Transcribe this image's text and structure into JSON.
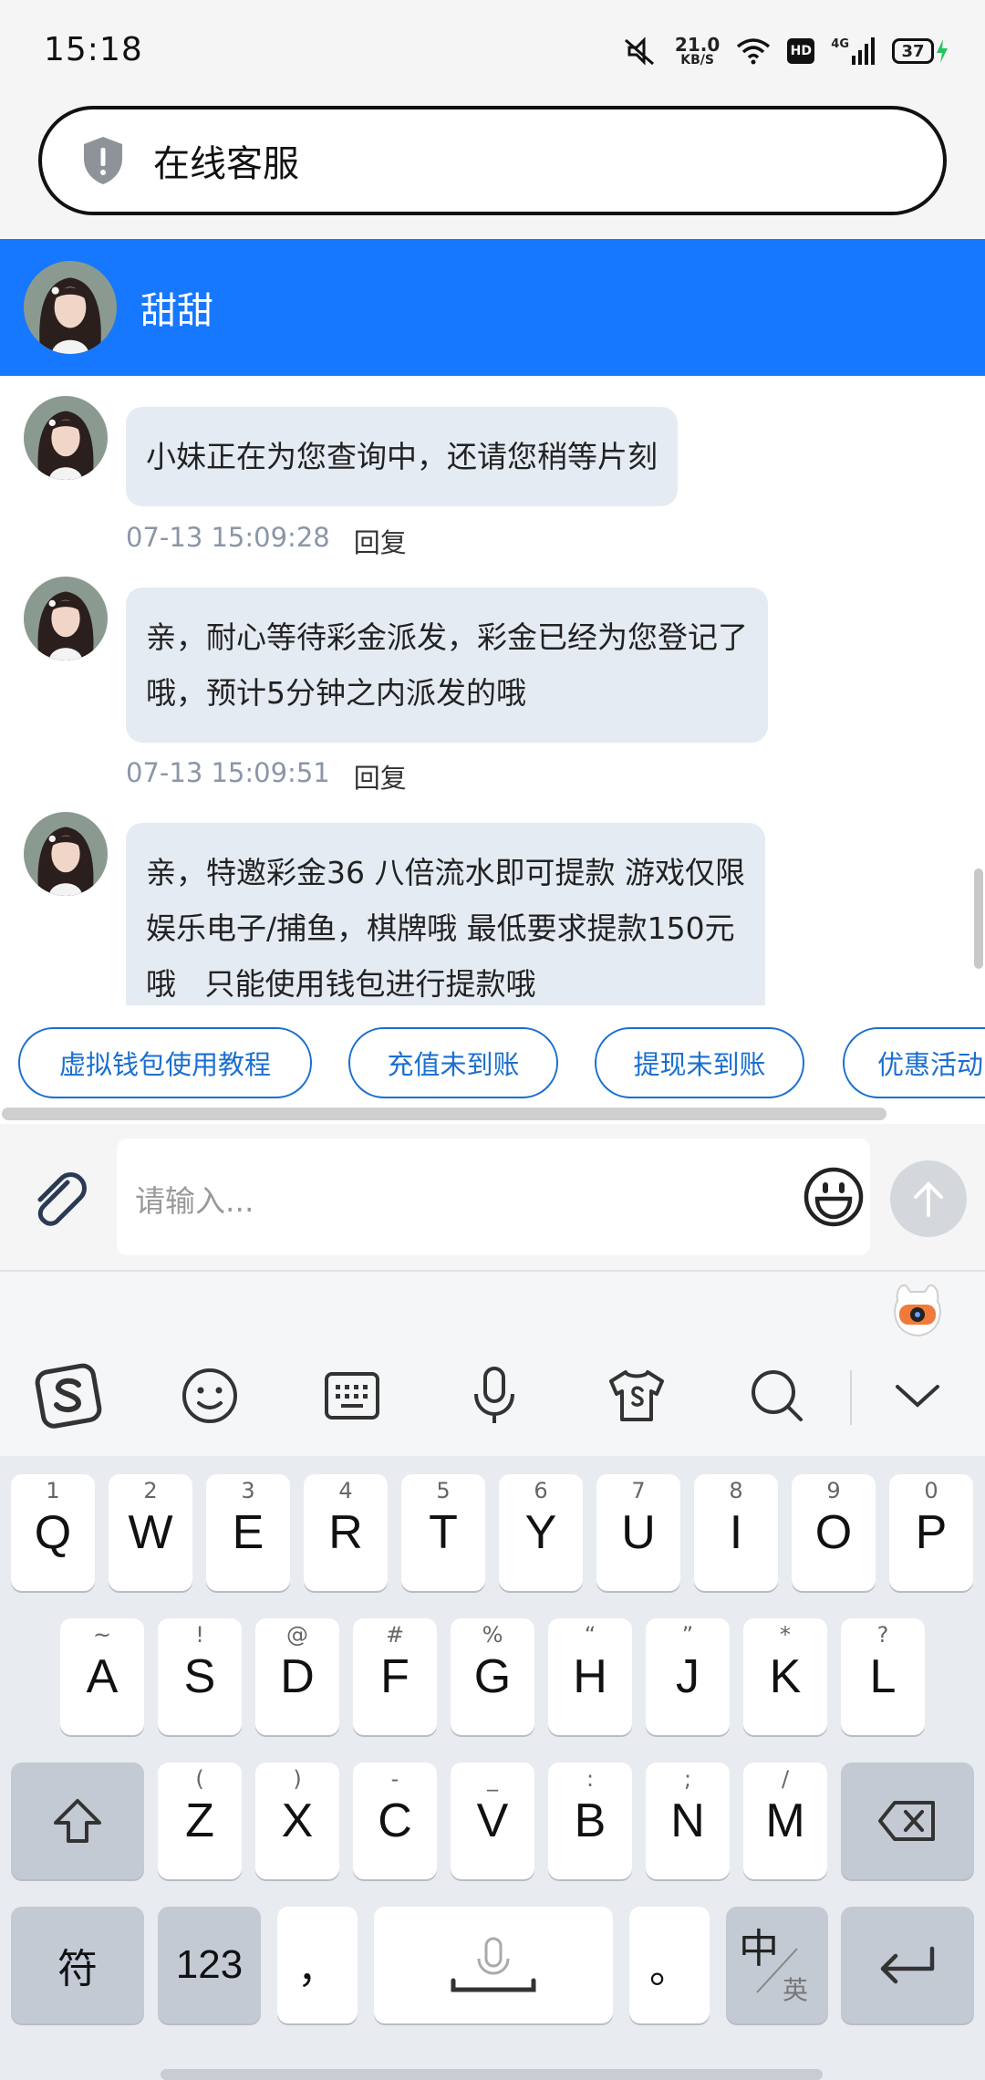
{
  "status_bar": {
    "time": "15:18",
    "net_speed_value": "21.0",
    "net_speed_unit": "KB/S",
    "hd_label": "HD",
    "network_label": "4G",
    "battery": "37"
  },
  "browser": {
    "page_title": "在线客服"
  },
  "chat": {
    "agent_name": "甜甜",
    "reply_label": "回复",
    "messages": [
      {
        "lines": [
          "小妹正在为您查询中，还请您稍等片刻"
        ],
        "time": "07-13 15:09:28"
      },
      {
        "lines": [
          "亲，耐心等待彩金派发，彩金已经为您登记了",
          "哦，预计5分钟之内派发的哦"
        ],
        "time": "07-13 15:09:51"
      },
      {
        "lines": [
          "亲，特邀彩金36 八倍流水即可提款 游戏仅限",
          "娱乐电子/捕鱼，棋牌哦  最低要求提款150元",
          "哦   只能使用钱包进行提款哦"
        ],
        "time": ""
      }
    ]
  },
  "quick_replies": [
    "虚拟钱包使用教程",
    "充值未到账",
    "提现未到账",
    "优惠活动"
  ],
  "input": {
    "placeholder": "请输入..."
  },
  "keyboard": {
    "row1": [
      {
        "k": "Q",
        "s": "1"
      },
      {
        "k": "W",
        "s": "2"
      },
      {
        "k": "E",
        "s": "3"
      },
      {
        "k": "R",
        "s": "4"
      },
      {
        "k": "T",
        "s": "5"
      },
      {
        "k": "Y",
        "s": "6"
      },
      {
        "k": "U",
        "s": "7"
      },
      {
        "k": "I",
        "s": "8"
      },
      {
        "k": "O",
        "s": "9"
      },
      {
        "k": "P",
        "s": "0"
      }
    ],
    "row2": [
      {
        "k": "A",
        "s": "~"
      },
      {
        "k": "S",
        "s": "!"
      },
      {
        "k": "D",
        "s": "@"
      },
      {
        "k": "F",
        "s": "#"
      },
      {
        "k": "G",
        "s": "%"
      },
      {
        "k": "H",
        "s": "“"
      },
      {
        "k": "J",
        "s": "”"
      },
      {
        "k": "K",
        "s": "*"
      },
      {
        "k": "L",
        "s": "?"
      }
    ],
    "row3": [
      {
        "k": "Z",
        "s": "("
      },
      {
        "k": "X",
        "s": ")"
      },
      {
        "k": "C",
        "s": "-"
      },
      {
        "k": "V",
        "s": "_"
      },
      {
        "k": "B",
        "s": ":"
      },
      {
        "k": "N",
        "s": ";"
      },
      {
        "k": "M",
        "s": "/"
      }
    ],
    "symbol_key": "符",
    "number_key": "123",
    "comma_key": "，",
    "period_key": "。",
    "lang_key_main": "中",
    "lang_key_sub": "英"
  },
  "icons": [
    "mute-icon",
    "wifi-icon",
    "signal-icon",
    "battery-icon",
    "shield-icon",
    "paperclip-icon",
    "emoji-icon",
    "send-arrow-icon",
    "sogou-logo-icon",
    "keyboard-icon",
    "mic-icon",
    "tshirt-icon",
    "search-icon",
    "chevron-down-icon",
    "shift-icon",
    "backspace-icon",
    "enter-icon"
  ],
  "colors": {
    "header_blue": "#1677ff",
    "bubble_bg": "#e5ebf3",
    "quick_reply_blue": "#1a6fd1"
  }
}
